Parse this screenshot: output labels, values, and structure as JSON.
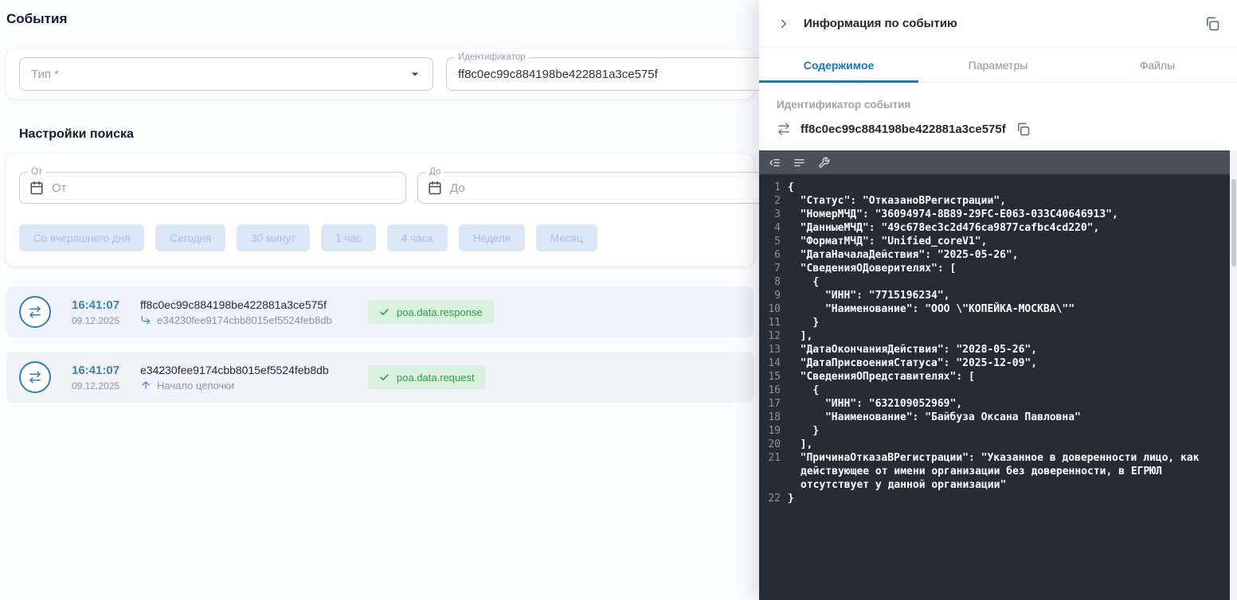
{
  "page": {
    "title": "События"
  },
  "colors": {
    "accent": "#1976d2",
    "success": "#27a347",
    "link_blue": "#3d7ecb"
  },
  "filters": {
    "type_label": "Тип *",
    "identifier_label": "Идентификатор",
    "identifier_value": "ff8c0ec99c884198be422881a3ce575f"
  },
  "search": {
    "title": "Настройки поиска",
    "from_label": "От",
    "from_placeholder": "От",
    "to_label": "До",
    "to_placeholder": "До",
    "quick_ranges": [
      "Со вчерашнего дня",
      "Сегодня",
      "30 минут",
      "1 час",
      "4 часа",
      "Неделя",
      "Месяц"
    ]
  },
  "events": [
    {
      "time": "16:41:07",
      "date": "09.12.2025",
      "id": "ff8c0ec99c884198be422881a3ce575f",
      "link": "e34230fee9174cbb8015ef5524feb8db",
      "link_icon": "corner-down-right",
      "badge": "poa.data.response"
    },
    {
      "time": "16:41:07",
      "date": "09.12.2025",
      "id": "e34230fee9174cbb8015ef5524feb8db",
      "link": "Начало цепочки",
      "link_icon": "arrow-up",
      "badge": "poa.data.request"
    }
  ],
  "panel": {
    "title": "Информация по событию",
    "tabs": [
      {
        "id": "content",
        "label": "Содержимое",
        "active": true
      },
      {
        "id": "parameters",
        "label": "Параметры",
        "active": false
      },
      {
        "id": "files",
        "label": "Файлы",
        "active": false
      }
    ],
    "event_id_label": "Идентификатор события",
    "event_id": "ff8c0ec99c884198be422881a3ce575f",
    "code_lines": [
      "{",
      "  \"Статус\": \"ОтказаноВРегистрации\",",
      "  \"НомерМЧД\": \"36094974-8B89-29FC-E063-033C40646913\",",
      "  \"ДанныеМЧД\": \"49c678ec3c2d476ca9877cafbc4cd220\",",
      "  \"ФорматМЧД\": \"Unified_coreV1\",",
      "  \"ДатаНачалаДействия\": \"2025-05-26\",",
      "  \"СведенияОДоверителях\": [",
      "    {",
      "      \"ИНН\": \"7715196234\",",
      "      \"Наименование\": \"ООО \\\"КОПЕЙКА-МОСКВА\\\"\"",
      "    }",
      "  ],",
      "  \"ДатаОкончанияДействия\": \"2028-05-26\",",
      "  \"ДатаПрисвоенияСтатуса\": \"2025-12-09\",",
      "  \"СведенияОПредставителях\": [",
      "    {",
      "      \"ИНН\": \"632109052969\",",
      "      \"Наименование\": \"Байбуза Оксана Павловна\"",
      "    }",
      "  ],",
      "  \"ПричинаОтказаВРегистрации\": \"Указанное в доверенности лицо, как действующее от имени организации без доверенности, в ЕГРЮЛ отсутствует у данной организации\"",
      "}"
    ]
  }
}
